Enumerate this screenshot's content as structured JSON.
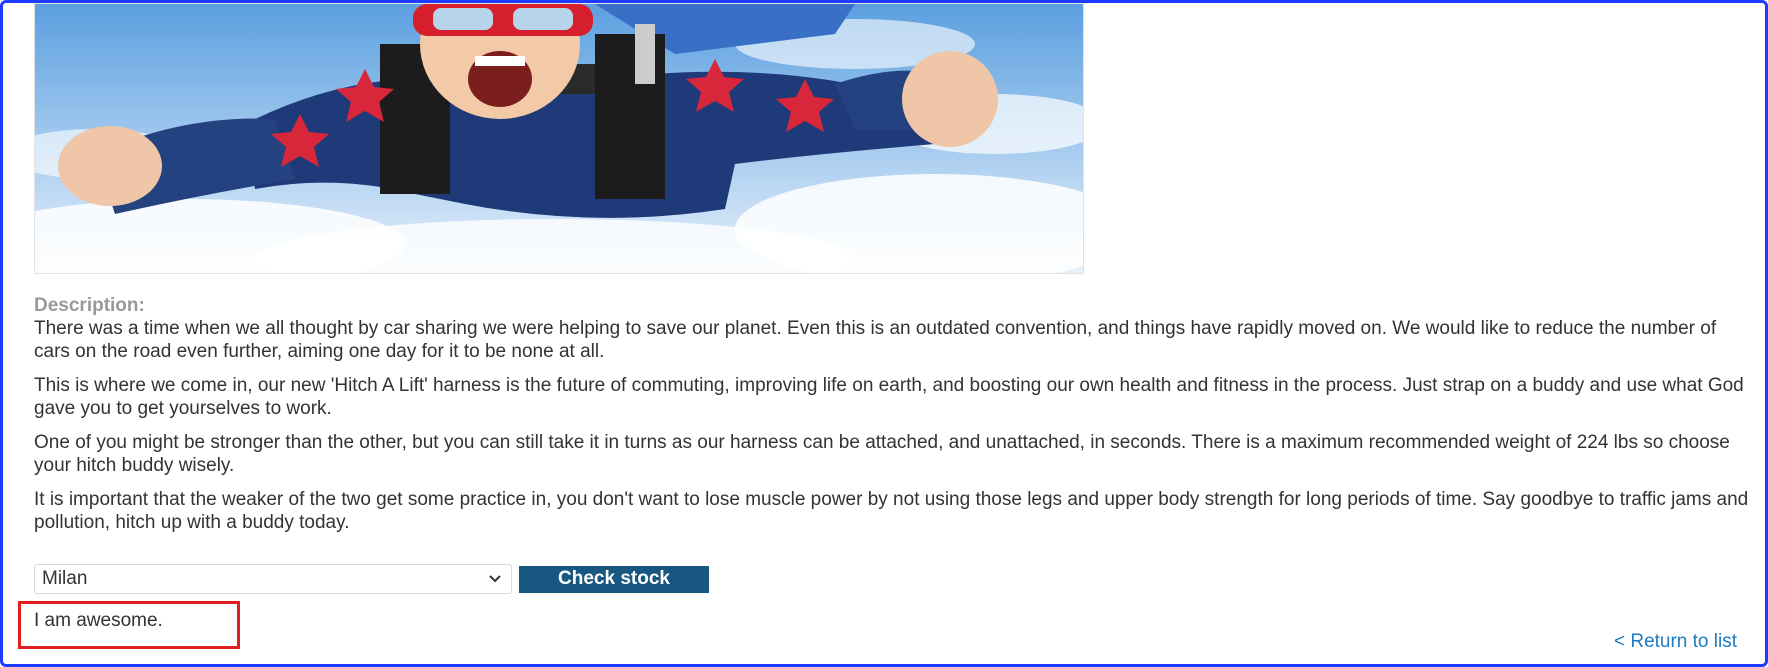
{
  "product": {
    "image_alt": "Man skydiving with a buddy harness"
  },
  "description": {
    "label": "Description:",
    "paragraphs": [
      "There was a time when we all thought by car sharing we were helping to save our planet. Even this is an outdated convention, and things have rapidly moved on. We would like to reduce the number of cars on the road even further, aiming one day for it to be none at all.",
      "This is where we come in, our new 'Hitch A Lift' harness is the future of commuting, improving life on earth, and boosting our own health and fitness in the process. Just strap on a buddy and use what God gave you to get yourselves to work.",
      "One of you might be stronger than the other, but you can still take it in turns as our harness can be attached, and unattached, in seconds. There is a maximum recommended weight of 224 lbs so choose your hitch buddy wisely.",
      "It is important that the weaker of the two get some practice in, you don't want to lose muscle power by not using those legs and upper body strength for long periods of time. Say goodbye to traffic jams and pollution, hitch up with a buddy today."
    ]
  },
  "stock_check": {
    "selected_store": "Milan",
    "button_label": "Check stock",
    "result_text": "I am awesome."
  },
  "navigation": {
    "return_link": "< Return to list"
  },
  "colors": {
    "button_bg": "#18577f",
    "link": "#1c7bc1",
    "highlight_border": "#e02020",
    "frame_border": "#1e3cff"
  },
  "icons": {
    "select_arrow": "chevron-down-icon"
  }
}
